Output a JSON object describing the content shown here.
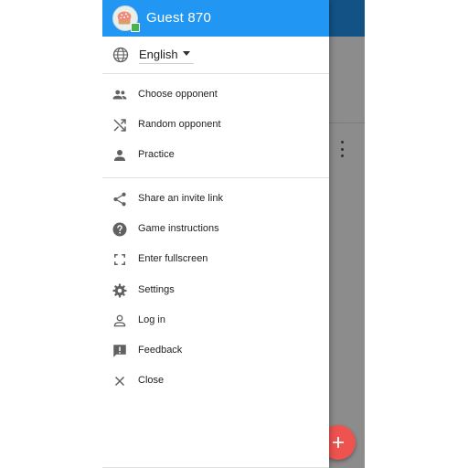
{
  "header": {
    "username": "Guest 870"
  },
  "language": {
    "selected": "English"
  },
  "menu_group_1": [
    {
      "label": "Choose opponent",
      "icon": "group-icon"
    },
    {
      "label": "Random opponent",
      "icon": "shuffle-icon"
    },
    {
      "label": "Practice",
      "icon": "person-icon"
    }
  ],
  "menu_group_2": [
    {
      "label": "Share an invite link",
      "icon": "share-icon"
    },
    {
      "label": "Game instructions",
      "icon": "help-icon"
    },
    {
      "label": "Enter fullscreen",
      "icon": "fullscreen-icon"
    },
    {
      "label": "Settings",
      "icon": "gear-icon"
    },
    {
      "label": "Log in",
      "icon": "person-outline-icon"
    },
    {
      "label": "Feedback",
      "icon": "feedback-icon"
    },
    {
      "label": "Close",
      "icon": "close-icon"
    }
  ],
  "colors": {
    "primary": "#2196f3",
    "fab": "#ef5350",
    "online_badge": "#4caf50",
    "icon": "#616161"
  }
}
